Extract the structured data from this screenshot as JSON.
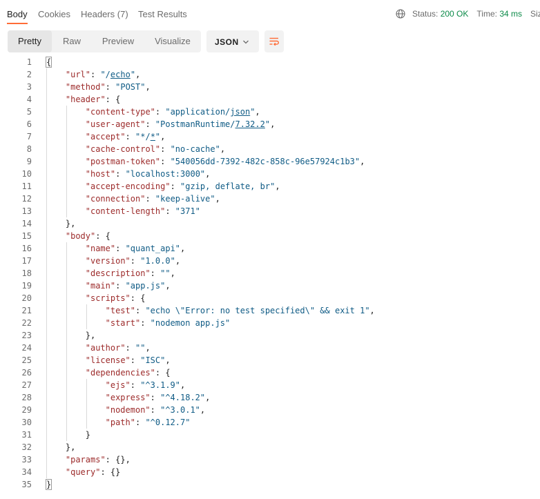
{
  "tabs": [
    {
      "label": "Body",
      "active": true
    },
    {
      "label": "Cookies",
      "active": false
    },
    {
      "label": "Headers",
      "count": "(7)",
      "active": false
    },
    {
      "label": "Test Results",
      "active": false
    }
  ],
  "status": {
    "status_label": "Status:",
    "status_value": "200 OK",
    "time_label": "Time:",
    "time_value": "34 ms",
    "size_label": "Siz"
  },
  "view_modes": [
    "Pretty",
    "Raw",
    "Preview",
    "Visualize"
  ],
  "active_view": "Pretty",
  "format_selected": "JSON",
  "accent_color": "#ff6c37",
  "icons": [
    "globe-icon",
    "chevron-down-icon",
    "wrap-lines-icon"
  ],
  "json_lines": [
    {
      "n": "1",
      "indent": 0,
      "parts": [
        [
          "p",
          "{"
        ]
      ]
    },
    {
      "n": "2",
      "indent": 1,
      "parts": [
        [
          "k",
          "\"url\""
        ],
        [
          "p",
          ": "
        ],
        [
          "s",
          "\"/"
        ],
        [
          "su",
          "echo"
        ],
        [
          "s",
          "\""
        ],
        [
          "p",
          ","
        ]
      ]
    },
    {
      "n": "3",
      "indent": 1,
      "parts": [
        [
          "k",
          "\"method\""
        ],
        [
          "p",
          ": "
        ],
        [
          "s",
          "\"POST\""
        ],
        [
          "p",
          ","
        ]
      ]
    },
    {
      "n": "4",
      "indent": 1,
      "parts": [
        [
          "k",
          "\"header\""
        ],
        [
          "p",
          ": {"
        ]
      ]
    },
    {
      "n": "5",
      "indent": 2,
      "parts": [
        [
          "k",
          "\"content-type\""
        ],
        [
          "p",
          ": "
        ],
        [
          "s",
          "\"application/"
        ],
        [
          "su",
          "json"
        ],
        [
          "s",
          "\""
        ],
        [
          "p",
          ","
        ]
      ]
    },
    {
      "n": "6",
      "indent": 2,
      "parts": [
        [
          "k",
          "\"user-agent\""
        ],
        [
          "p",
          ": "
        ],
        [
          "s",
          "\"PostmanRuntime/"
        ],
        [
          "su",
          "7.32.2"
        ],
        [
          "s",
          "\""
        ],
        [
          "p",
          ","
        ]
      ]
    },
    {
      "n": "7",
      "indent": 2,
      "parts": [
        [
          "k",
          "\"accept\""
        ],
        [
          "p",
          ": "
        ],
        [
          "s",
          "\"*/"
        ],
        [
          "su",
          "*"
        ],
        [
          "s",
          "\""
        ],
        [
          "p",
          ","
        ]
      ]
    },
    {
      "n": "8",
      "indent": 2,
      "parts": [
        [
          "k",
          "\"cache-control\""
        ],
        [
          "p",
          ": "
        ],
        [
          "s",
          "\"no-cache\""
        ],
        [
          "p",
          ","
        ]
      ]
    },
    {
      "n": "9",
      "indent": 2,
      "parts": [
        [
          "k",
          "\"postman-token\""
        ],
        [
          "p",
          ": "
        ],
        [
          "s",
          "\"540056dd-7392-482c-858c-96e57924c1b3\""
        ],
        [
          "p",
          ","
        ]
      ]
    },
    {
      "n": "10",
      "indent": 2,
      "parts": [
        [
          "k",
          "\"host\""
        ],
        [
          "p",
          ": "
        ],
        [
          "s",
          "\"localhost:3000\""
        ],
        [
          "p",
          ","
        ]
      ]
    },
    {
      "n": "11",
      "indent": 2,
      "parts": [
        [
          "k",
          "\"accept-encoding\""
        ],
        [
          "p",
          ": "
        ],
        [
          "s",
          "\"gzip, deflate, br\""
        ],
        [
          "p",
          ","
        ]
      ]
    },
    {
      "n": "12",
      "indent": 2,
      "parts": [
        [
          "k",
          "\"connection\""
        ],
        [
          "p",
          ": "
        ],
        [
          "s",
          "\"keep-alive\""
        ],
        [
          "p",
          ","
        ]
      ]
    },
    {
      "n": "13",
      "indent": 2,
      "parts": [
        [
          "k",
          "\"content-length\""
        ],
        [
          "p",
          ": "
        ],
        [
          "s",
          "\"371\""
        ]
      ]
    },
    {
      "n": "14",
      "indent": 1,
      "parts": [
        [
          "p",
          "},"
        ]
      ]
    },
    {
      "n": "15",
      "indent": 1,
      "parts": [
        [
          "k",
          "\"body\""
        ],
        [
          "p",
          ": {"
        ]
      ]
    },
    {
      "n": "16",
      "indent": 2,
      "parts": [
        [
          "k",
          "\"name\""
        ],
        [
          "p",
          ": "
        ],
        [
          "s",
          "\"quant_api\""
        ],
        [
          "p",
          ","
        ]
      ]
    },
    {
      "n": "17",
      "indent": 2,
      "parts": [
        [
          "k",
          "\"version\""
        ],
        [
          "p",
          ": "
        ],
        [
          "s",
          "\"1.0.0\""
        ],
        [
          "p",
          ","
        ]
      ]
    },
    {
      "n": "18",
      "indent": 2,
      "parts": [
        [
          "k",
          "\"description\""
        ],
        [
          "p",
          ": "
        ],
        [
          "s",
          "\"\""
        ],
        [
          "p",
          ","
        ]
      ]
    },
    {
      "n": "19",
      "indent": 2,
      "parts": [
        [
          "k",
          "\"main\""
        ],
        [
          "p",
          ": "
        ],
        [
          "s",
          "\"app.js\""
        ],
        [
          "p",
          ","
        ]
      ]
    },
    {
      "n": "20",
      "indent": 2,
      "parts": [
        [
          "k",
          "\"scripts\""
        ],
        [
          "p",
          ": {"
        ]
      ]
    },
    {
      "n": "21",
      "indent": 3,
      "parts": [
        [
          "k",
          "\"test\""
        ],
        [
          "p",
          ": "
        ],
        [
          "s",
          "\"echo \\\"Error: no test specified\\\" && exit 1\""
        ],
        [
          "p",
          ","
        ]
      ]
    },
    {
      "n": "22",
      "indent": 3,
      "parts": [
        [
          "k",
          "\"start\""
        ],
        [
          "p",
          ": "
        ],
        [
          "s",
          "\"nodemon app.js\""
        ]
      ]
    },
    {
      "n": "23",
      "indent": 2,
      "parts": [
        [
          "p",
          "},"
        ]
      ]
    },
    {
      "n": "24",
      "indent": 2,
      "parts": [
        [
          "k",
          "\"author\""
        ],
        [
          "p",
          ": "
        ],
        [
          "s",
          "\"\""
        ],
        [
          "p",
          ","
        ]
      ]
    },
    {
      "n": "25",
      "indent": 2,
      "parts": [
        [
          "k",
          "\"license\""
        ],
        [
          "p",
          ": "
        ],
        [
          "s",
          "\"ISC\""
        ],
        [
          "p",
          ","
        ]
      ]
    },
    {
      "n": "26",
      "indent": 2,
      "parts": [
        [
          "k",
          "\"dependencies\""
        ],
        [
          "p",
          ": {"
        ]
      ]
    },
    {
      "n": "27",
      "indent": 3,
      "parts": [
        [
          "k",
          "\"ejs\""
        ],
        [
          "p",
          ": "
        ],
        [
          "s",
          "\"^3.1.9\""
        ],
        [
          "p",
          ","
        ]
      ]
    },
    {
      "n": "28",
      "indent": 3,
      "parts": [
        [
          "k",
          "\"express\""
        ],
        [
          "p",
          ": "
        ],
        [
          "s",
          "\"^4.18.2\""
        ],
        [
          "p",
          ","
        ]
      ]
    },
    {
      "n": "29",
      "indent": 3,
      "parts": [
        [
          "k",
          "\"nodemon\""
        ],
        [
          "p",
          ": "
        ],
        [
          "s",
          "\"^3.0.1\""
        ],
        [
          "p",
          ","
        ]
      ]
    },
    {
      "n": "30",
      "indent": 3,
      "parts": [
        [
          "k",
          "\"path\""
        ],
        [
          "p",
          ": "
        ],
        [
          "s",
          "\"^0.12.7\""
        ]
      ]
    },
    {
      "n": "31",
      "indent": 2,
      "parts": [
        [
          "p",
          "}"
        ]
      ]
    },
    {
      "n": "32",
      "indent": 1,
      "parts": [
        [
          "p",
          "},"
        ]
      ]
    },
    {
      "n": "33",
      "indent": 1,
      "parts": [
        [
          "k",
          "\"params\""
        ],
        [
          "p",
          ": {},"
        ]
      ]
    },
    {
      "n": "34",
      "indent": 1,
      "parts": [
        [
          "k",
          "\"query\""
        ],
        [
          "p",
          ": {}"
        ]
      ]
    },
    {
      "n": "35",
      "indent": 0,
      "parts": [
        [
          "p",
          "}"
        ]
      ]
    }
  ]
}
